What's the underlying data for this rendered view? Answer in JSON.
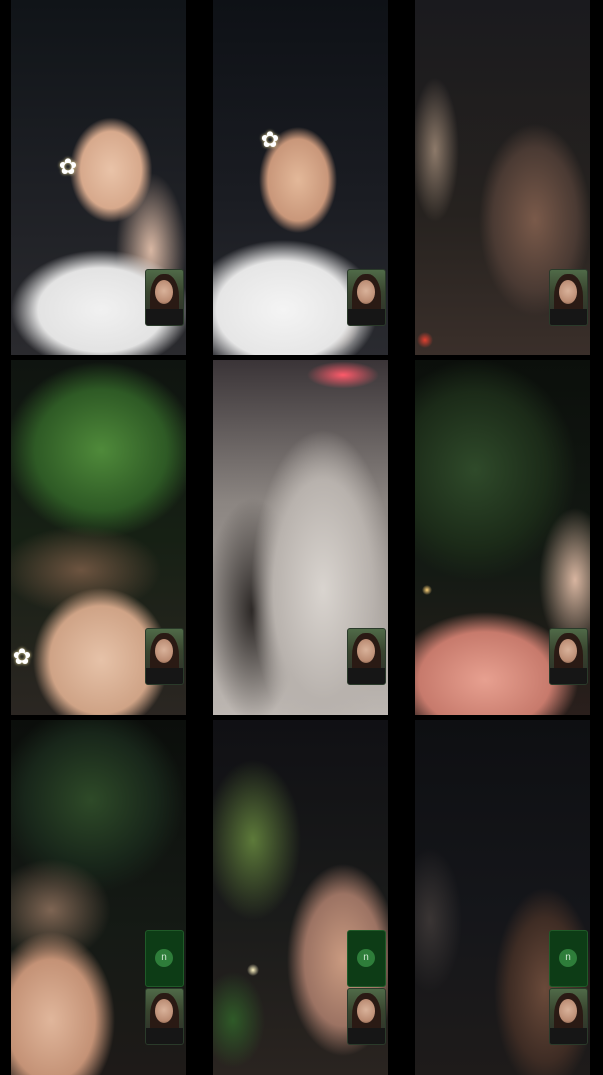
{
  "grid": {
    "tiles": [
      {
        "id": "r1c1",
        "has_avatar": false
      },
      {
        "id": "r1c2",
        "has_avatar": false
      },
      {
        "id": "r1c3",
        "has_avatar": false
      },
      {
        "id": "r2c1",
        "has_avatar": false
      },
      {
        "id": "r2c2",
        "has_avatar": false
      },
      {
        "id": "r2c3",
        "has_avatar": false
      },
      {
        "id": "r3c1",
        "has_avatar": true
      },
      {
        "id": "r3c2",
        "has_avatar": true
      },
      {
        "id": "r3c3",
        "has_avatar": true
      }
    ]
  },
  "avatar": {
    "initial": "n"
  },
  "icons": {
    "flower": "flower-icon",
    "avatar": "user-avatar-icon"
  },
  "colors": {
    "background": "#000000",
    "avatar_bg": "#0d3c16",
    "avatar_dot": "#2e7d3a"
  }
}
